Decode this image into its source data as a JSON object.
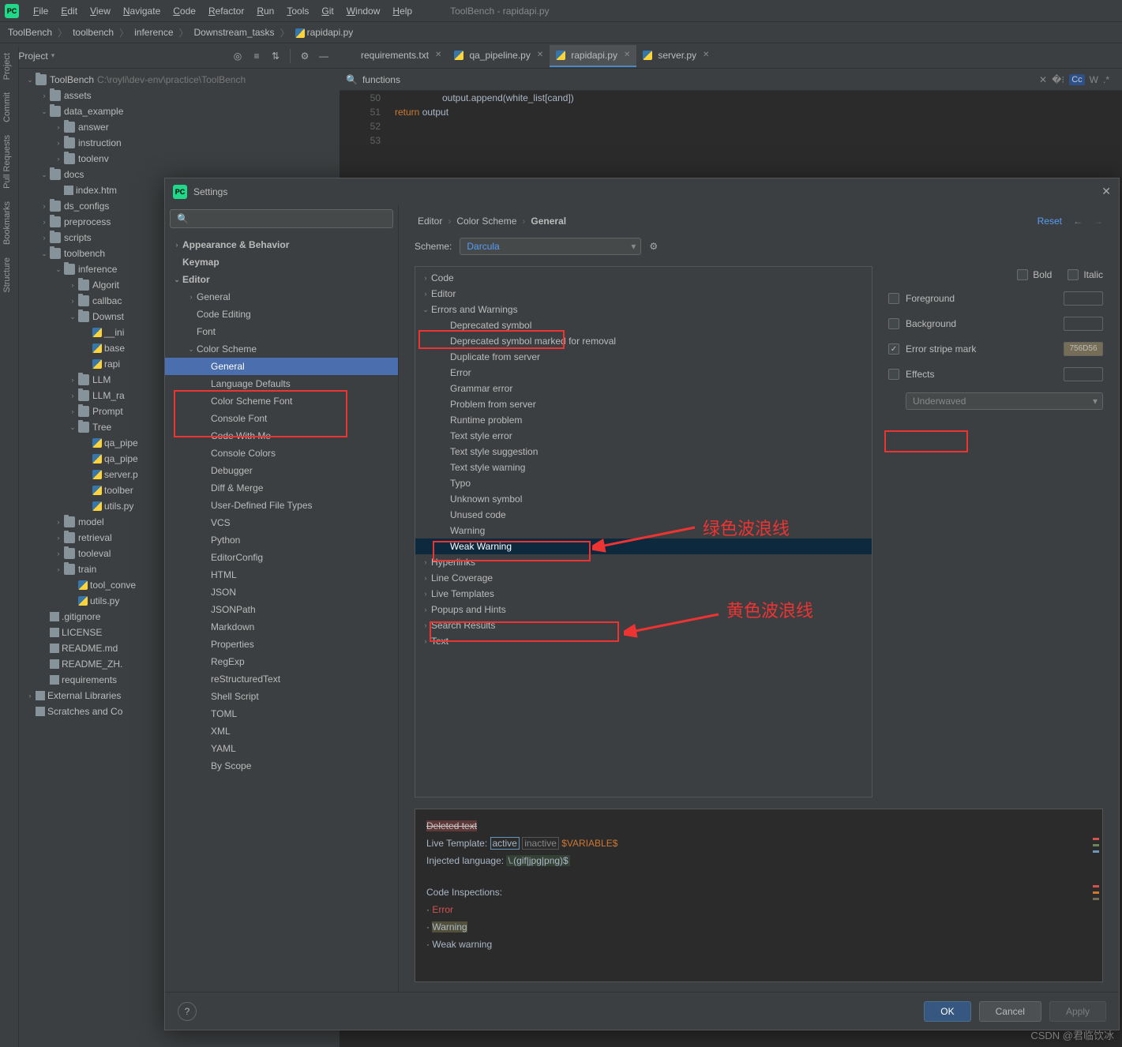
{
  "window_title": "ToolBench - rapidapi.py",
  "menus": [
    "File",
    "Edit",
    "View",
    "Navigate",
    "Code",
    "Refactor",
    "Run",
    "Tools",
    "Git",
    "Window",
    "Help"
  ],
  "breadcrumb": [
    "ToolBench",
    "toolbench",
    "inference",
    "Downstream_tasks",
    "rapidapi.py"
  ],
  "project_label": "Project",
  "tabs": [
    {
      "label": "requirements.txt",
      "icon": "txt"
    },
    {
      "label": "qa_pipeline.py",
      "icon": "py"
    },
    {
      "label": "rapidapi.py",
      "icon": "py",
      "active": true
    },
    {
      "label": "server.py",
      "icon": "py"
    }
  ],
  "search_placeholder": "functions",
  "gutter": [
    "50",
    "51",
    "52",
    "53"
  ],
  "code_line0": "output.append(white_list[cand])",
  "code_kw": "return",
  "code_rest": " output",
  "side_tabs": [
    "Project",
    "Commit",
    "Pull Requests",
    "Bookmarks",
    "Structure"
  ],
  "tree": [
    {
      "d": 0,
      "c": "v",
      "t": "folder",
      "l": "ToolBench",
      "p": "C:\\royli\\dev-env\\practice\\ToolBench"
    },
    {
      "d": 1,
      "c": ">",
      "t": "folder",
      "l": "assets"
    },
    {
      "d": 1,
      "c": "v",
      "t": "folder",
      "l": "data_example"
    },
    {
      "d": 2,
      "c": ">",
      "t": "folder",
      "l": "answer"
    },
    {
      "d": 2,
      "c": ">",
      "t": "folder",
      "l": "instruction"
    },
    {
      "d": 2,
      "c": ">",
      "t": "folder",
      "l": "toolenv"
    },
    {
      "d": 1,
      "c": "v",
      "t": "folder",
      "l": "docs"
    },
    {
      "d": 2,
      "c": "",
      "t": "html",
      "l": "index.htm"
    },
    {
      "d": 1,
      "c": ">",
      "t": "folder",
      "l": "ds_configs"
    },
    {
      "d": 1,
      "c": ">",
      "t": "folder",
      "l": "preprocess"
    },
    {
      "d": 1,
      "c": ">",
      "t": "folder",
      "l": "scripts"
    },
    {
      "d": 1,
      "c": "v",
      "t": "folder",
      "l": "toolbench"
    },
    {
      "d": 2,
      "c": "v",
      "t": "folder",
      "l": "inference"
    },
    {
      "d": 3,
      "c": ">",
      "t": "folder",
      "l": "Algorit"
    },
    {
      "d": 3,
      "c": ">",
      "t": "folder",
      "l": "callbac"
    },
    {
      "d": 3,
      "c": "v",
      "t": "folder",
      "l": "Downst"
    },
    {
      "d": 4,
      "c": "",
      "t": "py",
      "l": "__ini"
    },
    {
      "d": 4,
      "c": "",
      "t": "py",
      "l": "base"
    },
    {
      "d": 4,
      "c": "",
      "t": "py",
      "l": "rapi"
    },
    {
      "d": 3,
      "c": ">",
      "t": "folder",
      "l": "LLM"
    },
    {
      "d": 3,
      "c": ">",
      "t": "folder",
      "l": "LLM_ra"
    },
    {
      "d": 3,
      "c": ">",
      "t": "folder",
      "l": "Prompt"
    },
    {
      "d": 3,
      "c": "v",
      "t": "folder",
      "l": "Tree"
    },
    {
      "d": 4,
      "c": "",
      "t": "py",
      "l": "qa_pipe"
    },
    {
      "d": 4,
      "c": "",
      "t": "py",
      "l": "qa_pipe"
    },
    {
      "d": 4,
      "c": "",
      "t": "py",
      "l": "server.p"
    },
    {
      "d": 4,
      "c": "",
      "t": "py",
      "l": "toolber"
    },
    {
      "d": 4,
      "c": "",
      "t": "py",
      "l": "utils.py"
    },
    {
      "d": 2,
      "c": ">",
      "t": "folder",
      "l": "model"
    },
    {
      "d": 2,
      "c": ">",
      "t": "folder",
      "l": "retrieval"
    },
    {
      "d": 2,
      "c": ">",
      "t": "folder",
      "l": "tooleval"
    },
    {
      "d": 2,
      "c": ">",
      "t": "folder",
      "l": "train"
    },
    {
      "d": 3,
      "c": "",
      "t": "py",
      "l": "tool_conve"
    },
    {
      "d": 3,
      "c": "",
      "t": "py",
      "l": "utils.py"
    },
    {
      "d": 1,
      "c": "",
      "t": "git",
      "l": ".gitignore"
    },
    {
      "d": 1,
      "c": "",
      "t": "txt",
      "l": "LICENSE"
    },
    {
      "d": 1,
      "c": "",
      "t": "md",
      "l": "README.md"
    },
    {
      "d": 1,
      "c": "",
      "t": "md",
      "l": "README_ZH."
    },
    {
      "d": 1,
      "c": "",
      "t": "txt",
      "l": "requirements"
    },
    {
      "d": 0,
      "c": ">",
      "t": "lib",
      "l": "External Libraries"
    },
    {
      "d": 0,
      "c": "",
      "t": "scr",
      "l": "Scratches and Co"
    }
  ],
  "settings": {
    "title": "Settings",
    "search_ph": "",
    "nav": [
      {
        "l": "Appearance & Behavior",
        "d": 0,
        "c": ">",
        "b": true
      },
      {
        "l": "Keymap",
        "d": 0,
        "b": true
      },
      {
        "l": "Editor",
        "d": 0,
        "c": "v",
        "b": true
      },
      {
        "l": "General",
        "d": 1,
        "c": ">"
      },
      {
        "l": "Code Editing",
        "d": 1
      },
      {
        "l": "Font",
        "d": 1
      },
      {
        "l": "Color Scheme",
        "d": 1,
        "c": "v"
      },
      {
        "l": "General",
        "d": 2,
        "sel": true
      },
      {
        "l": "Language Defaults",
        "d": 2
      },
      {
        "l": "Color Scheme Font",
        "d": 2
      },
      {
        "l": "Console Font",
        "d": 2
      },
      {
        "l": "Code With Me",
        "d": 2
      },
      {
        "l": "Console Colors",
        "d": 2
      },
      {
        "l": "Debugger",
        "d": 2
      },
      {
        "l": "Diff & Merge",
        "d": 2
      },
      {
        "l": "User-Defined File Types",
        "d": 2
      },
      {
        "l": "VCS",
        "d": 2
      },
      {
        "l": "Python",
        "d": 2
      },
      {
        "l": "EditorConfig",
        "d": 2
      },
      {
        "l": "HTML",
        "d": 2
      },
      {
        "l": "JSON",
        "d": 2
      },
      {
        "l": "JSONPath",
        "d": 2
      },
      {
        "l": "Markdown",
        "d": 2
      },
      {
        "l": "Properties",
        "d": 2
      },
      {
        "l": "RegExp",
        "d": 2
      },
      {
        "l": "reStructuredText",
        "d": 2
      },
      {
        "l": "Shell Script",
        "d": 2
      },
      {
        "l": "TOML",
        "d": 2
      },
      {
        "l": "XML",
        "d": 2
      },
      {
        "l": "YAML",
        "d": 2
      },
      {
        "l": "By Scope",
        "d": 2
      }
    ],
    "bc": [
      "Editor",
      "Color Scheme",
      "General"
    ],
    "reset": "Reset",
    "scheme_label": "Scheme:",
    "scheme_value": "Darcula",
    "opts": [
      {
        "l": "Code",
        "d": 0,
        "c": ">"
      },
      {
        "l": "Editor",
        "d": 0,
        "c": ">"
      },
      {
        "l": "Errors and Warnings",
        "d": 0,
        "c": "v"
      },
      {
        "l": "Deprecated symbol",
        "d": 1
      },
      {
        "l": "Deprecated symbol marked for removal",
        "d": 1
      },
      {
        "l": "Duplicate from server",
        "d": 1
      },
      {
        "l": "Error",
        "d": 1
      },
      {
        "l": "Grammar error",
        "d": 1
      },
      {
        "l": "Problem from server",
        "d": 1
      },
      {
        "l": "Runtime problem",
        "d": 1
      },
      {
        "l": "Text style error",
        "d": 1
      },
      {
        "l": "Text style suggestion",
        "d": 1
      },
      {
        "l": "Text style warning",
        "d": 1
      },
      {
        "l": "Typo",
        "d": 1
      },
      {
        "l": "Unknown symbol",
        "d": 1
      },
      {
        "l": "Unused code",
        "d": 1
      },
      {
        "l": "Warning",
        "d": 1
      },
      {
        "l": "Weak Warning",
        "d": 1,
        "sel": true
      },
      {
        "l": "Hyperlinks",
        "d": 0,
        "c": ">"
      },
      {
        "l": "Line Coverage",
        "d": 0,
        "c": ">"
      },
      {
        "l": "Live Templates",
        "d": 0,
        "c": ">"
      },
      {
        "l": "Popups and Hints",
        "d": 0,
        "c": ">"
      },
      {
        "l": "Search Results",
        "d": 0,
        "c": ">"
      },
      {
        "l": "Text",
        "d": 0,
        "c": ">"
      }
    ],
    "panel": {
      "bold": "Bold",
      "italic": "Italic",
      "fg": "Foreground",
      "bg": "Background",
      "stripe": "Error stripe mark",
      "stripe_val": "756D56",
      "effects": "Effects",
      "effect_type": "Underwaved"
    },
    "preview": {
      "deleted": "Deleted text",
      "lt_label": "Live Template:",
      "lt_active": "active",
      "lt_inactive": "inactive",
      "lt_var": "$VARIABLE$",
      "inj_label": "Injected language:",
      "inj_val": "\\.(gif|jpg|png)$",
      "ci": "Code Inspections:",
      "err": "Error",
      "warn": "Warning",
      "weak": "Weak warning"
    },
    "buttons": {
      "ok": "OK",
      "cancel": "Cancel",
      "apply": "Apply"
    }
  },
  "annotations": {
    "green": "绿色波浪线",
    "yellow": "黄色波浪线"
  },
  "watermark": "CSDN @君临饮冰"
}
